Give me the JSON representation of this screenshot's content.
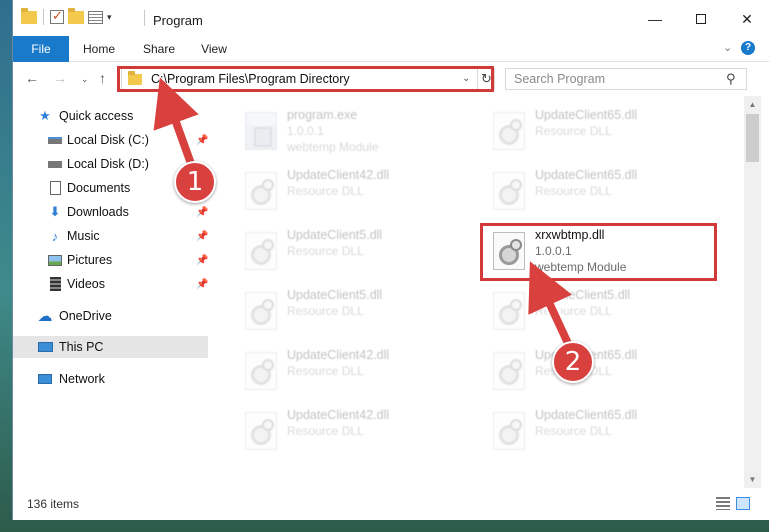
{
  "window": {
    "title": "Program",
    "minimize_glyph": "—",
    "close_glyph": "✕"
  },
  "ribbon": {
    "tabs": [
      "File",
      "Home",
      "Share",
      "View"
    ],
    "expand_glyph": "⌄"
  },
  "address_bar": {
    "path": "C:\\Program Files\\Program Directory",
    "dropdown_glyph": "⌄",
    "refresh_glyph": "↻"
  },
  "search": {
    "placeholder": "Search Program",
    "icon_glyph": "⚲"
  },
  "nav_buttons": {
    "back": "←",
    "forward": "→",
    "recent": "⌄",
    "up": "↑"
  },
  "navigation_pane": {
    "quick_access": "Quick access",
    "items": [
      {
        "label": "Local Disk (C:)",
        "icon": "drive-icon",
        "pinned": true
      },
      {
        "label": "Local Disk (D:)",
        "icon": "drive-icon",
        "pinned": false
      },
      {
        "label": "Documents",
        "icon": "documents-icon",
        "pinned": true
      },
      {
        "label": "Downloads",
        "icon": "download-icon",
        "pinned": true
      },
      {
        "label": "Music",
        "icon": "music-icon",
        "pinned": true
      },
      {
        "label": "Pictures",
        "icon": "pictures-icon",
        "pinned": true
      },
      {
        "label": "Videos",
        "icon": "videos-icon",
        "pinned": true
      }
    ],
    "onedrive": "OneDrive",
    "this_pc": "This PC",
    "network": "Network",
    "pin_glyph": "📌"
  },
  "files": [
    {
      "name": "program.exe",
      "line2": "1.0.0.1",
      "line3": "webtemp Module",
      "type": "exe",
      "faded": true
    },
    {
      "name": "UpdateClient65.dll",
      "line2": "Resource DLL",
      "line3": "",
      "type": "dll",
      "faded": true
    },
    {
      "name": "UpdateClient42.dll",
      "line2": "Resource DLL",
      "line3": "",
      "type": "dll",
      "faded": true
    },
    {
      "name": "UpdateClient65.dll",
      "line2": "Resource DLL",
      "line3": "",
      "type": "dll",
      "faded": true
    },
    {
      "name": "UpdateClient5.dll",
      "line2": "Resource DLL",
      "line3": "",
      "type": "dll",
      "faded": true
    },
    {
      "name": "xrxwbtmp.dll",
      "line2": "1.0.0.1",
      "line3": "webtemp Module",
      "type": "dll",
      "faded": false
    },
    {
      "name": "UpdateClient5.dll",
      "line2": "Resource DLL",
      "line3": "",
      "type": "dll",
      "faded": true
    },
    {
      "name": "UpdateClient5.dll",
      "line2": "Resource DLL",
      "line3": "",
      "type": "dll",
      "faded": true
    },
    {
      "name": "UpdateClient42.dll",
      "line2": "Resource DLL",
      "line3": "",
      "type": "dll",
      "faded": true
    },
    {
      "name": "UpdateClient65.dll",
      "line2": "Resource DLL",
      "line3": "",
      "type": "dll",
      "faded": true
    },
    {
      "name": "UpdateClient42.dll",
      "line2": "Resource DLL",
      "line3": "",
      "type": "dll",
      "faded": true
    },
    {
      "name": "UpdateClient65.dll",
      "line2": "Resource DLL",
      "line3": "",
      "type": "dll",
      "faded": true
    }
  ],
  "status": {
    "item_count": "136 items"
  },
  "annotations": {
    "step1": "1",
    "step2": "2",
    "color": "#d9413f"
  },
  "colors": {
    "accent": "#1979ca",
    "highlight": "#d23a3a",
    "selected_nav": "#e5e5e5"
  }
}
